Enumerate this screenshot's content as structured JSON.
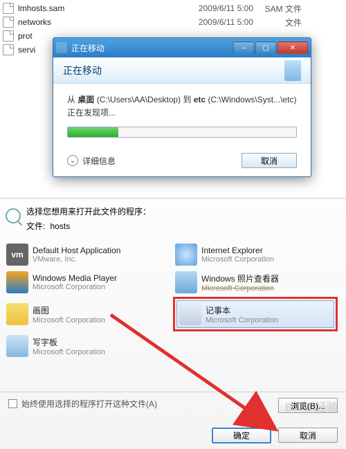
{
  "files": [
    {
      "name": "lmhosts.sam",
      "date": "2009/6/11 5:00",
      "type": "SAM 文件"
    },
    {
      "name": "networks",
      "date": "2009/6/11 5:00",
      "type": "文件"
    },
    {
      "name": "prot",
      "date": "",
      "type": ""
    },
    {
      "name": "servi",
      "date": "",
      "type": ""
    }
  ],
  "dialog": {
    "title": "正在移动",
    "banner": "正在移动",
    "msg_prefix": "从 ",
    "msg_src_bold": "桌面",
    "msg_src_path": " (C:\\Users\\AA\\Desktop) 到 ",
    "msg_dst_bold": "etc",
    "msg_dst_path": " (C:\\Windows\\Syst...\\etc)",
    "discovering": "正在发现项...",
    "details": "详细信息",
    "cancel": "取消",
    "min": "–",
    "max": "▢",
    "close": "✕"
  },
  "openwith": {
    "prompt": "选择您想用来打开此文件的程序：",
    "file_label": "文件:",
    "file_name": "hosts",
    "programs": [
      {
        "name": "Default Host Application",
        "vendor": "VMware, Inc.",
        "icon": "vm",
        "label": "vm"
      },
      {
        "name": "Internet Explorer",
        "vendor": "Microsoft Corporation",
        "icon": "ie"
      },
      {
        "name": "Windows Media Player",
        "vendor": "Microsoft Corporation",
        "icon": "wmp"
      },
      {
        "name": "Windows 照片查看器",
        "vendor": "Microsoft Corporation",
        "icon": "photo",
        "strike": true
      },
      {
        "name": "画图",
        "vendor": "Microsoft Corporation",
        "icon": "paint"
      },
      {
        "name": "记事本",
        "vendor": "Microsoft Corporation",
        "icon": "notepad"
      },
      {
        "name": "写字板",
        "vendor": "Microsoft Corporation",
        "icon": "wordpad"
      }
    ],
    "always_checkbox": "始终使用选择的程序打开这种文件(A)",
    "browse": "浏览(B)...",
    "ok": "确定",
    "cancel": "取消"
  },
  "watermark": "Baidu经验"
}
